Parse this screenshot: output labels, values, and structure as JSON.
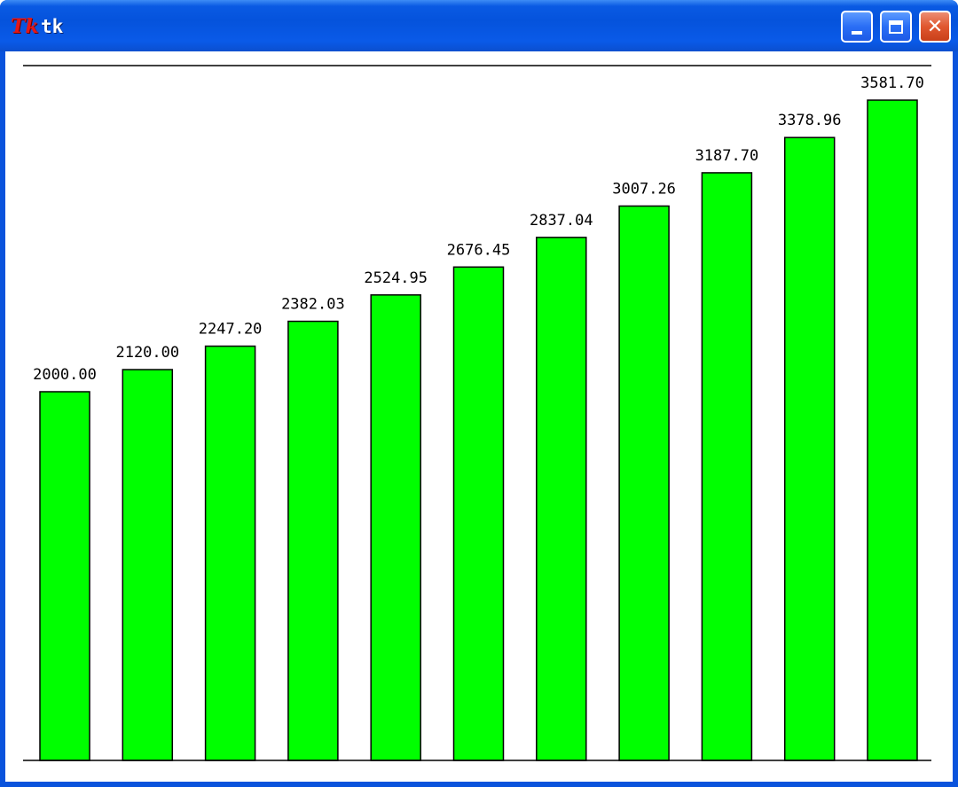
{
  "window": {
    "title": "tk",
    "icon": "tk-logo-icon",
    "icon_text": "Tk",
    "buttons": {
      "minimize": "minimize-icon",
      "maximize": "maximize-icon",
      "close": "close-icon",
      "close_glyph": "✕"
    }
  },
  "colors": {
    "bar_fill": "#00ff00",
    "bar_stroke": "#000000",
    "background": "#ffffff"
  },
  "chart_data": {
    "type": "bar",
    "categories": [],
    "values": [
      2000.0,
      2120.0,
      2247.2,
      2382.03,
      2524.95,
      2676.45,
      2837.04,
      3007.26,
      3187.7,
      3378.96,
      3581.7
    ],
    "labels": [
      "2000.00",
      "2120.00",
      "2247.20",
      "2382.03",
      "2524.95",
      "2676.45",
      "2837.04",
      "3007.26",
      "3187.70",
      "3378.96",
      "3581.70"
    ],
    "title": "",
    "xlabel": "",
    "ylabel": "",
    "ylim": [
      0,
      3800
    ],
    "grid": false
  }
}
